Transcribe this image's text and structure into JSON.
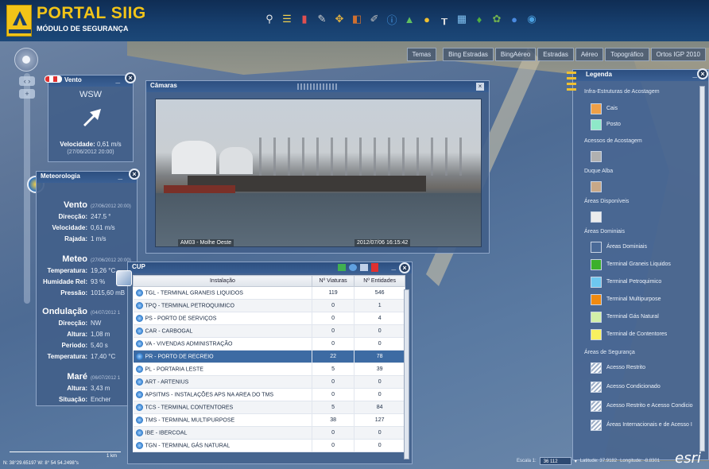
{
  "header": {
    "title": "PORTAL SIIG",
    "subtitle": "MÓDULO DE SEGURANÇA",
    "tools": [
      "pin-icon",
      "list-icon",
      "book-icon",
      "measure-icon",
      "locate-icon",
      "layers-icon",
      "draw-icon",
      "info-icon",
      "photo-icon",
      "globe-icon",
      "ruler-icon",
      "table-icon",
      "pin-green-icon",
      "camera-icon",
      "help-icon",
      "weather-icon"
    ]
  },
  "basemaps": [
    "Temas",
    "Bing Estradas",
    "BingAéreo",
    "Estradas",
    "Aéreo",
    "Topográfico",
    "Ortos IGP 2010"
  ],
  "wind_panel": {
    "title": "Vento",
    "direction": "WSW",
    "velocity_label": "Velocidade:",
    "velocity_value": "0,61 m/s",
    "date": "(27/06/2012 20:00)"
  },
  "meteo_panel": {
    "title": "Meteorologia",
    "vento": {
      "heading": "Vento",
      "date": "(27/06/2012 20:00)",
      "rows": [
        {
          "label": "Direcção:",
          "value": "247.5 °"
        },
        {
          "label": "Velocidade:",
          "value": "0,61 m/s"
        },
        {
          "label": "Rajada:",
          "value": "1 m/s"
        }
      ]
    },
    "meteo": {
      "heading": "Meteo",
      "date": "(27/06/2012 20:00)",
      "rows": [
        {
          "label": "Temperatura:",
          "value": "19,26 °C"
        },
        {
          "label": "Humidade Rel:",
          "value": "93 %"
        },
        {
          "label": "Pressão:",
          "value": "1015,60 mB"
        }
      ]
    },
    "ondulacao": {
      "heading": "Ondulação",
      "date": "(04/07/2012 1",
      "rows": [
        {
          "label": "Direcção:",
          "value": "NW"
        },
        {
          "label": "Altura:",
          "value": "1,08 m"
        },
        {
          "label": "Periodo:",
          "value": "5,40 s"
        },
        {
          "label": "Temperatura:",
          "value": "17,40 °C"
        }
      ]
    },
    "mare": {
      "heading": "Maré",
      "date": "(06/07/2012 1",
      "rows": [
        {
          "label": "Altura:",
          "value": "3,43 m"
        },
        {
          "label": "Situação:",
          "value": "Encher"
        }
      ]
    }
  },
  "camera_panel": {
    "title": "Câmaras",
    "camera_name": "AM03 - Molhe Oeste",
    "timestamp": "2012/07/06  16:15:42"
  },
  "cup_panel": {
    "title": "CUP",
    "columns": [
      "Instalação",
      "Nº Viaturas",
      "Nº Entidades"
    ],
    "rows": [
      {
        "name": "TGL - TERMINAL GRANEIS LIQUIDOS",
        "viaturas": "119",
        "entidades": "546"
      },
      {
        "name": "TPQ - TERMINAL PETROQUIMICO",
        "viaturas": "0",
        "entidades": "1"
      },
      {
        "name": "PS - PORTO DE SERVIÇOS",
        "viaturas": "0",
        "entidades": "4"
      },
      {
        "name": "CAR - CARBOGAL",
        "viaturas": "0",
        "entidades": "0"
      },
      {
        "name": "VA - VIVENDAS ADMINISTRAÇÃO",
        "viaturas": "0",
        "entidades": "0"
      },
      {
        "name": "PR - PORTO DE RECREIO",
        "viaturas": "22",
        "entidades": "78"
      },
      {
        "name": "PL - PORTARIA LESTE",
        "viaturas": "5",
        "entidades": "39"
      },
      {
        "name": "ART - ARTENIUS",
        "viaturas": "0",
        "entidades": "0"
      },
      {
        "name": "APSITMS - INSTALAÇÕES APS NA AREA DO TMS",
        "viaturas": "0",
        "entidades": "0"
      },
      {
        "name": "TCS - TERMINAL CONTENTORES",
        "viaturas": "5",
        "entidades": "84"
      },
      {
        "name": "TMS - TERMINAL MULTIPURPOSE",
        "viaturas": "38",
        "entidades": "127"
      },
      {
        "name": "IBE - IBERCOAL",
        "viaturas": "0",
        "entidades": "0"
      },
      {
        "name": "TGN - TERMINAL GÁS NATURAL",
        "viaturas": "0",
        "entidades": "0"
      }
    ],
    "selected_row": 5
  },
  "legend_panel": {
    "title": "Legenda",
    "section1": "Infra-Estruturas de Acostagem",
    "cais": {
      "label": "Cais",
      "color": "#f0a048"
    },
    "posto": {
      "label": "Posto",
      "color": "#8ee8c8"
    },
    "section2": "Acessos de Acostagem",
    "acessos_color": "#b0b0b0",
    "section3": "Duque Alba",
    "duque_color": "#c8a888",
    "section4": "Áreas Disponíveis",
    "disponiveis_color": "#ececec",
    "section5": "Áreas Dominiais",
    "dominiais": [
      {
        "label": "Áreas Dominiais",
        "color": "#4a6a98"
      },
      {
        "label": "Terminal Graneis Liquidos",
        "color": "#3cb02c"
      },
      {
        "label": "Terminal Petroquimico",
        "color": "#6ec8f0"
      },
      {
        "label": "Terminal Multipurpose",
        "color": "#f08a10"
      },
      {
        "label": "Terminal Gás Natural",
        "color": "#d2f0a8"
      },
      {
        "label": "Terminal de Contentores",
        "color": "#f8f060"
      }
    ],
    "section6": "Áreas de Segurança",
    "seguranca": [
      "Acesso Restrito",
      "Acesso Condicionado",
      "Acesso Restrito e Acesso Condicio",
      "Áreas Internacionais e de Acesso I"
    ]
  },
  "status": {
    "scale_label": "1 km",
    "coords": "N: 38°29.65197 W: 8° 54 54.2498\"s",
    "escala_label": "Escala 1:",
    "escala_value": "36 112",
    "latitude": "Latitude: 37.9182",
    "longitude": "Longitude: -8.8301",
    "esri": "esri"
  }
}
